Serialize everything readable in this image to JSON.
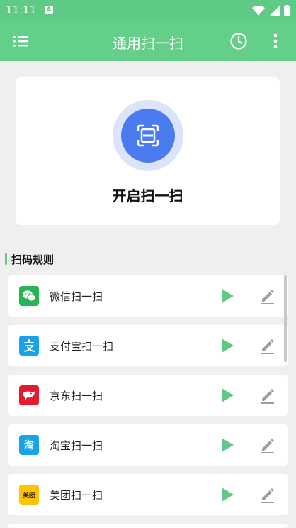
{
  "status_bar": {
    "time": "11:11",
    "notification_letter": "A"
  },
  "app_bar": {
    "title": "通用扫一扫",
    "menu_icon": "list-menu-icon",
    "history_icon": "clock-history-icon",
    "more_icon": "more-vert-icon"
  },
  "scan_card": {
    "label": "开启扫一扫",
    "icon": "scan-frame-icon"
  },
  "rules_section": {
    "title": "扫码规则"
  },
  "rules": [
    {
      "label": "微信扫一扫",
      "icon": "wechat-icon",
      "icon_color": "#27b456"
    },
    {
      "label": "支付宝扫一扫",
      "icon": "alipay-icon",
      "icon_color": "#18a2e8"
    },
    {
      "label": "京东扫一扫",
      "icon": "jd-icon",
      "icon_color": "#e51a2e"
    },
    {
      "label": "淘宝扫一扫",
      "icon": "taobao-icon",
      "icon_color": "#1aa3e9",
      "icon_text": "淘"
    },
    {
      "label": "美团扫一扫",
      "icon": "meituan-icon",
      "icon_color": "#ffc300",
      "icon_text": "美团"
    }
  ],
  "colors": {
    "primary": "#63cf89",
    "play": "#5fca86",
    "scan_button": "#4a7cf0"
  }
}
